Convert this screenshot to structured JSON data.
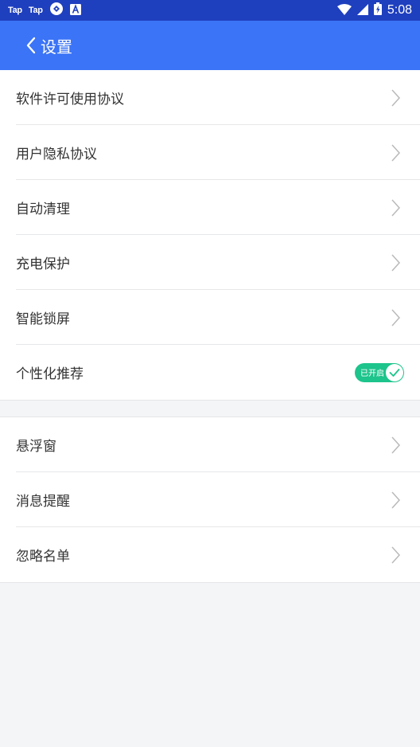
{
  "status_bar": {
    "left_items": [
      "Tap",
      "Tap"
    ],
    "time": "5:08",
    "icons": [
      "taptap-icon",
      "taptap-icon",
      "sync-icon",
      "a-icon",
      "wifi-icon",
      "signal-icon",
      "battery-charging-icon"
    ]
  },
  "header": {
    "title": "设置",
    "back_icon": "chevron-left-icon"
  },
  "sections": [
    {
      "items": [
        {
          "label": "软件许可使用协议",
          "control": "chevron"
        },
        {
          "label": "用户隐私协议",
          "control": "chevron"
        },
        {
          "label": "自动清理",
          "control": "chevron"
        },
        {
          "label": "充电保护",
          "control": "chevron"
        },
        {
          "label": "智能锁屏",
          "control": "chevron"
        },
        {
          "label": "个性化推荐",
          "control": "toggle",
          "toggle_text": "已开启",
          "toggle_on": true
        }
      ]
    },
    {
      "items": [
        {
          "label": "悬浮窗",
          "control": "chevron"
        },
        {
          "label": "消息提醒",
          "control": "chevron"
        },
        {
          "label": "忽略名单",
          "control": "chevron"
        }
      ]
    }
  ],
  "colors": {
    "status_bar": "#1e3fbe",
    "app_bar": "#3b74f6",
    "toggle_on": "#1dc48b",
    "background": "#f4f5f7"
  }
}
